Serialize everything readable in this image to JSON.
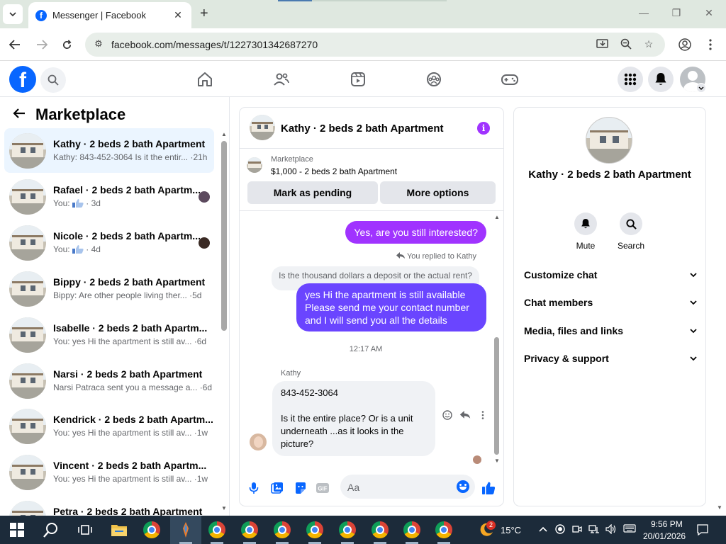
{
  "browser": {
    "tab_title": "Messenger | Facebook",
    "favicon_letter": "f",
    "url": "facebook.com/messages/t/1227301342687270"
  },
  "fb": {
    "logo_letter": "f"
  },
  "sidebar": {
    "title": "Marketplace",
    "conversations": [
      {
        "name": "Kathy · 2 beds 2 bath Apartment",
        "snippet": "Kathy: 843-452-3064 Is it the entir... ·21h",
        "active": true
      },
      {
        "name": "Rafael · 2 beds 2 bath Apartm...",
        "snippet_prefix": "You:",
        "snippet_suffix": "· 3d"
      },
      {
        "name": "Nicole · 2 beds 2 bath Apartm...",
        "snippet_prefix": "You:",
        "snippet_suffix": "· 4d"
      },
      {
        "name": "Bippy · 2 beds 2 bath Apartment",
        "snippet": "Bippy: Are other people living ther... ·5d"
      },
      {
        "name": "Isabelle · 2 beds 2 bath Apartm...",
        "snippet": "You: yes Hi the apartment is still av... ·6d"
      },
      {
        "name": "Narsi · 2 beds 2 bath Apartment",
        "snippet": "Narsi Patraca sent you a message a... ·6d"
      },
      {
        "name": "Kendrick · 2 beds 2 bath Apartm...",
        "snippet": "You: yes Hi the apartment is still av... ·1w"
      },
      {
        "name": "Vincent · 2 beds 2 bath Apartm...",
        "snippet": "You: yes Hi the apartment is still av... ·1w"
      },
      {
        "name": "Petra · 2 beds 2 bath Apartment",
        "snippet": ""
      }
    ]
  },
  "chat": {
    "title": "Kathy · 2 beds 2 bath Apartment",
    "marketplace_label": "Marketplace",
    "listing": "$1,000 - 2 beds 2 bath Apartment",
    "mark_pending_label": "Mark as pending",
    "more_options_label": "More options",
    "msg_out_1": "Yes, are you still interested?",
    "replied_label": "You replied to Kathy",
    "quoted_text": "Is the thousand dollars a deposit or the actual rent?",
    "msg_out_2": "yes Hi the apartment is still available Please send me your contact number and I will send you all the details",
    "timestamp": "12:17 AM",
    "sender_name": "Kathy",
    "msg_in": "843-452-3064\n\nIs it the entire place? Or is a unit underneath ...as it looks in the picture?",
    "composer_placeholder": "Aa"
  },
  "right_panel": {
    "name": "Kathy · 2 beds 2 bath Apartment",
    "mute_label": "Mute",
    "search_label": "Search",
    "sections": [
      "Customize chat",
      "Chat members",
      "Media, files and links",
      "Privacy & support"
    ]
  },
  "taskbar": {
    "weather_badge": "2",
    "temperature": "15°C",
    "time": "9:56 PM",
    "date": "20/01/2026"
  },
  "colors": {
    "fb_blue": "#0866ff",
    "messenger_purple": "#a033ff",
    "bubble_blue_purple": "#6a45ff"
  }
}
